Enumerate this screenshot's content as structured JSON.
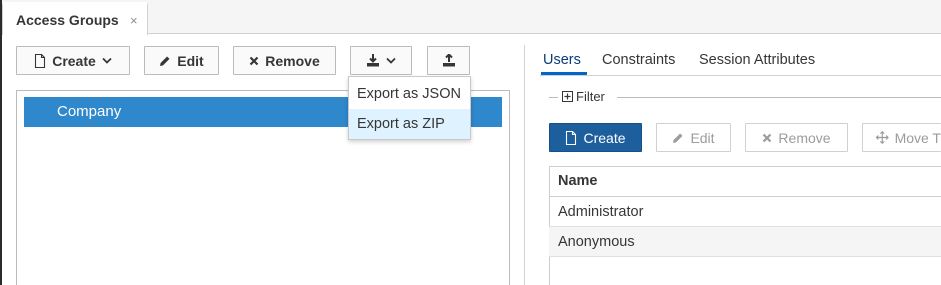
{
  "tab": {
    "title": "Access Groups",
    "close": "×"
  },
  "toolbar": {
    "create_label": "Create",
    "edit_label": "Edit",
    "remove_label": "Remove"
  },
  "tree": {
    "items": [
      "Company"
    ]
  },
  "export_menu": {
    "items": [
      "Export as JSON",
      "Export as ZIP"
    ],
    "hovered": "Export as ZIP"
  },
  "right_tabs": [
    {
      "label": "Users",
      "active": true
    },
    {
      "label": "Constraints",
      "active": false
    },
    {
      "label": "Session Attributes",
      "active": false
    }
  ],
  "filter": {
    "label": "Filter"
  },
  "users_toolbar": {
    "create_label": "Create",
    "edit_label": "Edit",
    "remove_label": "Remove",
    "move_label": "Move T"
  },
  "users_table": {
    "header": "Name",
    "rows": [
      "Administrator",
      "Anonymous"
    ]
  },
  "colors": {
    "accent": "#2f87cc",
    "primary_button": "#1d5f9c",
    "menu_hover": "#def3ff",
    "active_tab": "#0066cc"
  }
}
